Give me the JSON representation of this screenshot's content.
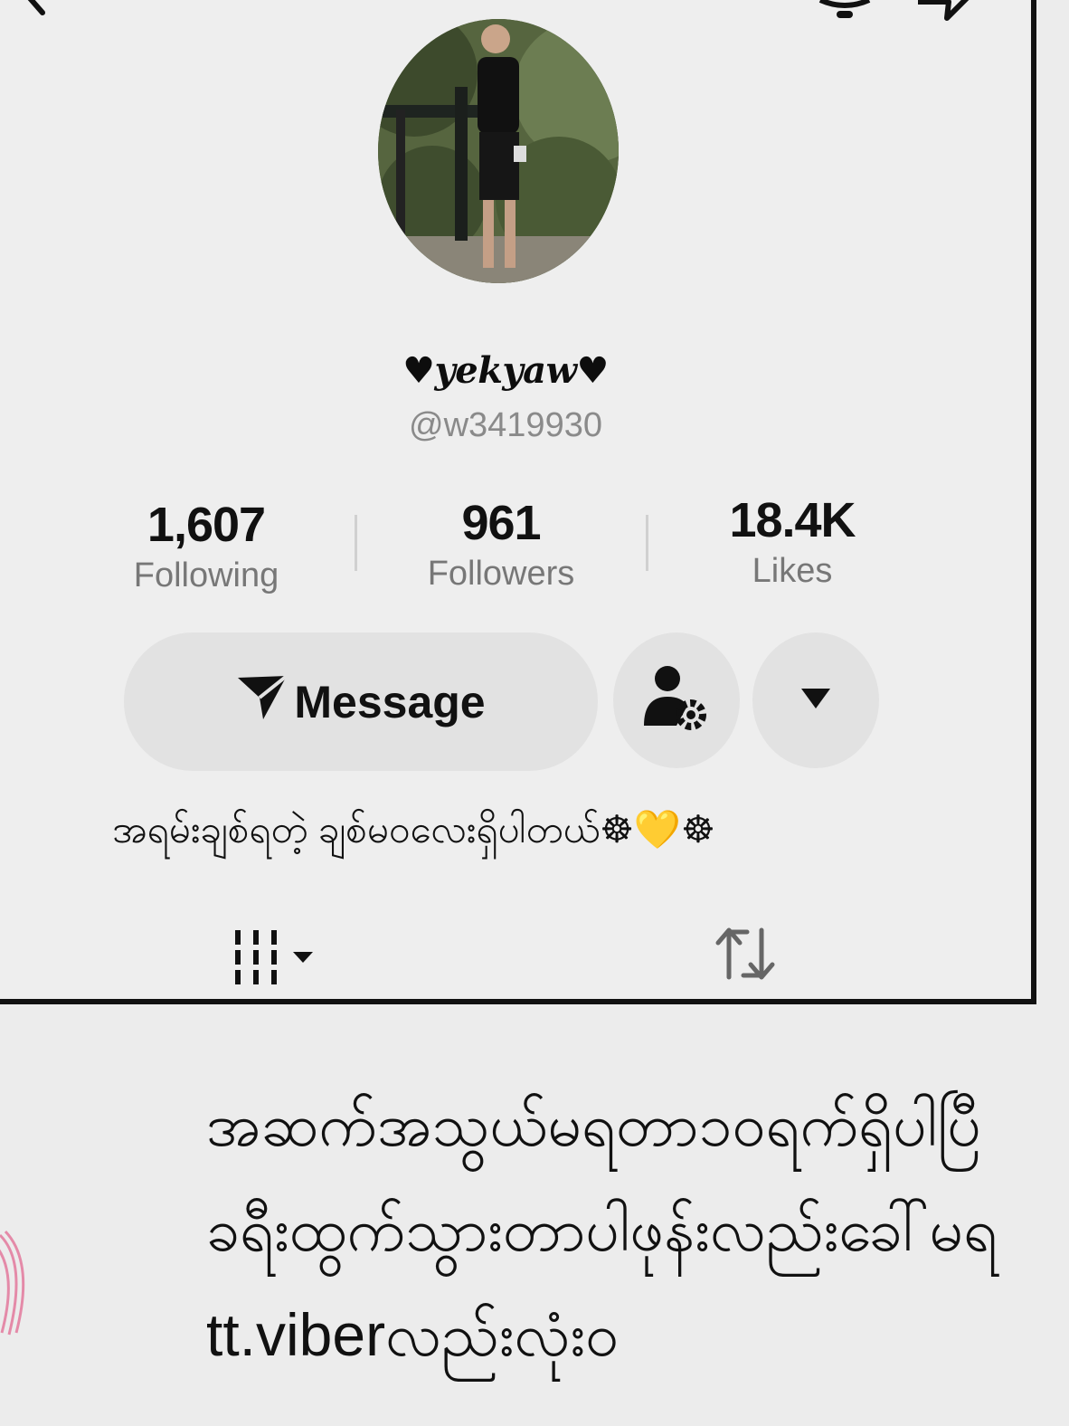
{
  "profile": {
    "display_name": "♥yekyaw♥",
    "handle": "@w3419930",
    "bio": "အရမ်းချစ်ရတဲ့ ချစ်မဝလေးရှိပါတယ်☸💛☸"
  },
  "stats": {
    "following": {
      "value": "1,607",
      "label": "Following"
    },
    "followers": {
      "value": "961",
      "label": "Followers"
    },
    "likes": {
      "value": "18.4K",
      "label": "Likes"
    }
  },
  "actions": {
    "message_label": "Message",
    "profile_settings_icon": "person-gear-icon",
    "more_icon": "caret-down-icon"
  },
  "tabs": [
    {
      "icon": "grid-icon"
    },
    {
      "icon": "repost-icon"
    }
  ],
  "caption": {
    "lines": [
      "အဆက်အသွယ်မရတာ၁၀ရက်ရှိပါပြီ",
      "ခရီးထွက်သွားတာပါဖုန်းလည်းခေါ်မရ",
      "tt.viberလည်းလုံး၀"
    ]
  },
  "colors": {
    "frame_border": "#111111",
    "button_bg": "#e2e2e2",
    "muted_text": "#777777",
    "heart_yellow": "#f2c94c"
  }
}
